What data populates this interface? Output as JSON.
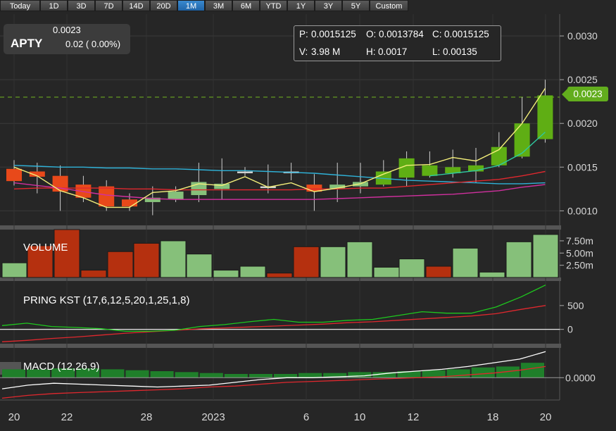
{
  "range_buttons": {
    "items": [
      "Today",
      "1D",
      "3D",
      "7D",
      "14D",
      "20D",
      "1M",
      "3M",
      "6M",
      "YTD",
      "1Y",
      "3Y",
      "5Y",
      "Custom"
    ],
    "active": "1M"
  },
  "quote": {
    "symbol": "APTY",
    "price": "0.0023",
    "change": "0.02 ( 0.00%)"
  },
  "ohlc_box": {
    "p_label": "P:",
    "p_value": "0.0015125",
    "o_label": "O:",
    "o_value": "0.0013784",
    "c_label": "C:",
    "c_value": "0.0015125",
    "v_label": "V:",
    "v_value": "3.98 M",
    "h_label": "H:",
    "h_value": "0.0017",
    "l_label": "L:",
    "l_value": "0.00135"
  },
  "last_price_tag": "0.0023",
  "colors": {
    "up": "#86c07a",
    "down": "#b5300f",
    "up_recent": "#5fae14",
    "ma_fast": "#f3ee7a",
    "ma_cyan": "#2fb2d8",
    "ma_red": "#e0282e",
    "ma_magenta": "#d0309e",
    "kst": "#1ec81e",
    "kst_signal": "#e0282e",
    "macd": "#ffffff",
    "macd_signal": "#e0282e",
    "macd_hist": "#1f7f2a",
    "last_price_line": "#6aa820"
  },
  "chart_data": [
    {
      "type": "candlestick",
      "title": "",
      "yticks": [
        "0.0010",
        "0.0015",
        "0.0020",
        "0.0025",
        "0.0030"
      ],
      "ylim": [
        0.00085,
        0.00325
      ],
      "last_price": 0.0023,
      "candles": [
        {
          "o": 0.00148,
          "h": 0.00158,
          "l": 0.00129,
          "c": 0.00134
        },
        {
          "o": 0.00145,
          "h": 0.00155,
          "l": 0.0012,
          "c": 0.00139
        },
        {
          "o": 0.0014,
          "h": 0.00152,
          "l": 0.001,
          "c": 0.00122
        },
        {
          "o": 0.0013,
          "h": 0.0014,
          "l": 0.0011,
          "c": 0.00115
        },
        {
          "o": 0.00128,
          "h": 0.00135,
          "l": 0.001,
          "c": 0.00105
        },
        {
          "o": 0.00113,
          "h": 0.0012,
          "l": 0.001,
          "c": 0.00105
        },
        {
          "o": 0.0011,
          "h": 0.00128,
          "l": 0.00095,
          "c": 0.00115
        },
        {
          "o": 0.00113,
          "h": 0.00128,
          "l": 0.0011,
          "c": 0.00122
        },
        {
          "o": 0.00118,
          "h": 0.00155,
          "l": 0.0011,
          "c": 0.00133
        },
        {
          "o": 0.00125,
          "h": 0.0016,
          "l": 0.00113,
          "c": 0.00131
        },
        {
          "o": 0.00145,
          "h": 0.0015,
          "l": 0.0014,
          "c": 0.00145
        },
        {
          "o": 0.00128,
          "h": 0.00153,
          "l": 0.0012,
          "c": 0.00128
        },
        {
          "o": 0.00145,
          "h": 0.00155,
          "l": 0.00135,
          "c": 0.00145
        },
        {
          "o": 0.0013,
          "h": 0.00142,
          "l": 0.001,
          "c": 0.00122
        },
        {
          "o": 0.00125,
          "h": 0.00155,
          "l": 0.0011,
          "c": 0.0013
        },
        {
          "o": 0.00128,
          "h": 0.00155,
          "l": 0.0012,
          "c": 0.00133
        },
        {
          "o": 0.0013,
          "h": 0.00158,
          "l": 0.00128,
          "c": 0.00145
        },
        {
          "o": 0.00138,
          "h": 0.00168,
          "l": 0.00128,
          "c": 0.0016
        },
        {
          "o": 0.0014,
          "h": 0.00168,
          "l": 0.00138,
          "c": 0.00152
        },
        {
          "o": 0.00143,
          "h": 0.0017,
          "l": 0.00138,
          "c": 0.0015
        },
        {
          "o": 0.00145,
          "h": 0.00172,
          "l": 0.00132,
          "c": 0.00152
        },
        {
          "o": 0.00152,
          "h": 0.0019,
          "l": 0.0015,
          "c": 0.00173
        },
        {
          "o": 0.00162,
          "h": 0.0023,
          "l": 0.0016,
          "c": 0.002
        },
        {
          "o": 0.00182,
          "h": 0.0025,
          "l": 0.00178,
          "c": 0.00232
        }
      ],
      "ma_fast": [
        0.0015,
        0.0014,
        0.00123,
        0.00115,
        0.00104,
        0.00104,
        0.00121,
        0.00123,
        0.00131,
        0.00129,
        0.00139,
        0.00127,
        0.00132,
        0.00122,
        0.00126,
        0.00131,
        0.00142,
        0.00152,
        0.00153,
        0.00161,
        0.00157,
        0.0017,
        0.002,
        0.0024
      ],
      "ma_cyan": [
        0.00152,
        0.00151,
        0.0015,
        0.0015,
        0.00149,
        0.00149,
        0.00148,
        0.00148,
        0.00147,
        0.00146,
        0.00146,
        0.00145,
        0.00144,
        0.00143,
        0.00141,
        0.00139,
        0.00137,
        0.00135,
        0.00134,
        0.00133,
        0.00132,
        0.00131,
        0.00131,
        0.00132
      ],
      "ma_red": [
        0.00125,
        0.00126,
        0.00126,
        0.00126,
        0.00126,
        0.00125,
        0.00125,
        0.00124,
        0.00124,
        0.00124,
        0.00124,
        0.00124,
        0.00124,
        0.00125,
        0.00125,
        0.00126,
        0.00126,
        0.00128,
        0.0013,
        0.00132,
        0.00134,
        0.00136,
        0.0014,
        0.00145
      ],
      "ma_magenta": [
        0.00132,
        0.00129,
        0.00126,
        0.00122,
        0.00118,
        0.00116,
        0.00114,
        0.00113,
        0.00113,
        0.00113,
        0.00113,
        0.00113,
        0.00113,
        0.00113,
        0.00114,
        0.00115,
        0.00116,
        0.00117,
        0.00118,
        0.00119,
        0.00121,
        0.00123,
        0.00127,
        0.0013
      ],
      "ma_green": [
        null,
        null,
        null,
        null,
        null,
        null,
        null,
        null,
        null,
        null,
        null,
        null,
        null,
        null,
        null,
        null,
        null,
        null,
        0.0014,
        0.00143,
        0.00146,
        0.00152,
        0.00166,
        0.0019
      ]
    },
    {
      "type": "bar",
      "title": "VOLUME",
      "yticks": [
        "2.50m",
        "5.00m",
        "7.50m"
      ],
      "ylim": [
        0,
        9.8
      ],
      "values": [
        3.0,
        6.5,
        9.8,
        1.5,
        5.3,
        7.0,
        7.5,
        4.8,
        1.5,
        2.3,
        0.9,
        6.3,
        6.3,
        7.3,
        2.1,
        3.8,
        2.3,
        6.0,
        1.1,
        7.3,
        8.8
      ],
      "direction": [
        "up",
        "down",
        "down",
        "down",
        "down",
        "down",
        "up",
        "up",
        "up",
        "up",
        "down",
        "down",
        "up",
        "up",
        "up",
        "up",
        "down",
        "up",
        "up",
        "up",
        "up"
      ]
    },
    {
      "type": "line",
      "title": "PRING KST (17,6,12,5,20,1,25,1,8)",
      "yticks": [
        "0",
        "500"
      ],
      "ylim": [
        -300,
        1000
      ],
      "kst": [
        80,
        130,
        60,
        40,
        15,
        -40,
        -40,
        -20,
        60,
        100,
        160,
        210,
        150,
        150,
        190,
        210,
        290,
        370,
        340,
        340,
        470,
        680,
        930
      ],
      "signal": [
        -260,
        -230,
        -190,
        -160,
        -120,
        -80,
        -50,
        -20,
        10,
        30,
        50,
        70,
        90,
        110,
        140,
        160,
        190,
        220,
        250,
        280,
        330,
        420,
        500
      ]
    },
    {
      "type": "line",
      "title": "MACD (12,26,9)",
      "yticks": [
        "0.0000"
      ],
      "ylim": [
        -0.00012,
        0.00016
      ],
      "macd": [
        -6e-05,
        -4e-05,
        -3e-05,
        -3.5e-05,
        -4e-05,
        -4.5e-05,
        -5e-05,
        -4.5e-05,
        -4e-05,
        -2.5e-05,
        -1e-05,
        0.0,
        0.0,
        5e-06,
        1e-05,
        2.5e-05,
        3.5e-05,
        4.5e-05,
        6e-05,
        8e-05,
        0.0001,
        0.00014
      ],
      "signal": [
        -0.00011,
        -9.5e-05,
        -8.5e-05,
        -8e-05,
        -7.5e-05,
        -7e-05,
        -6.5e-05,
        -6e-05,
        -5e-05,
        -4.5e-05,
        -3.5e-05,
        -2.5e-05,
        -2e-05,
        -1.5e-05,
        -1e-05,
        -5e-06,
        0.0,
        5e-06,
        1.5e-05,
        2.5e-05,
        4e-05,
        6e-05
      ],
      "histogram": [
        4.5e-05,
        4.5e-05,
        5e-05,
        5e-05,
        4.5e-05,
        4e-05,
        3.5e-05,
        3e-05,
        2.5e-05,
        2e-05,
        2e-05,
        2e-05,
        2.5e-05,
        2.5e-05,
        3e-05,
        3e-05,
        3.5e-05,
        4e-05,
        4.5e-05,
        5.5e-05,
        6e-05,
        8e-05
      ]
    },
    {
      "type": "axis",
      "x_tick_labels": [
        "20",
        "22",
        "28",
        "2023",
        "6",
        "10",
        "12",
        "18",
        "20"
      ]
    }
  ]
}
